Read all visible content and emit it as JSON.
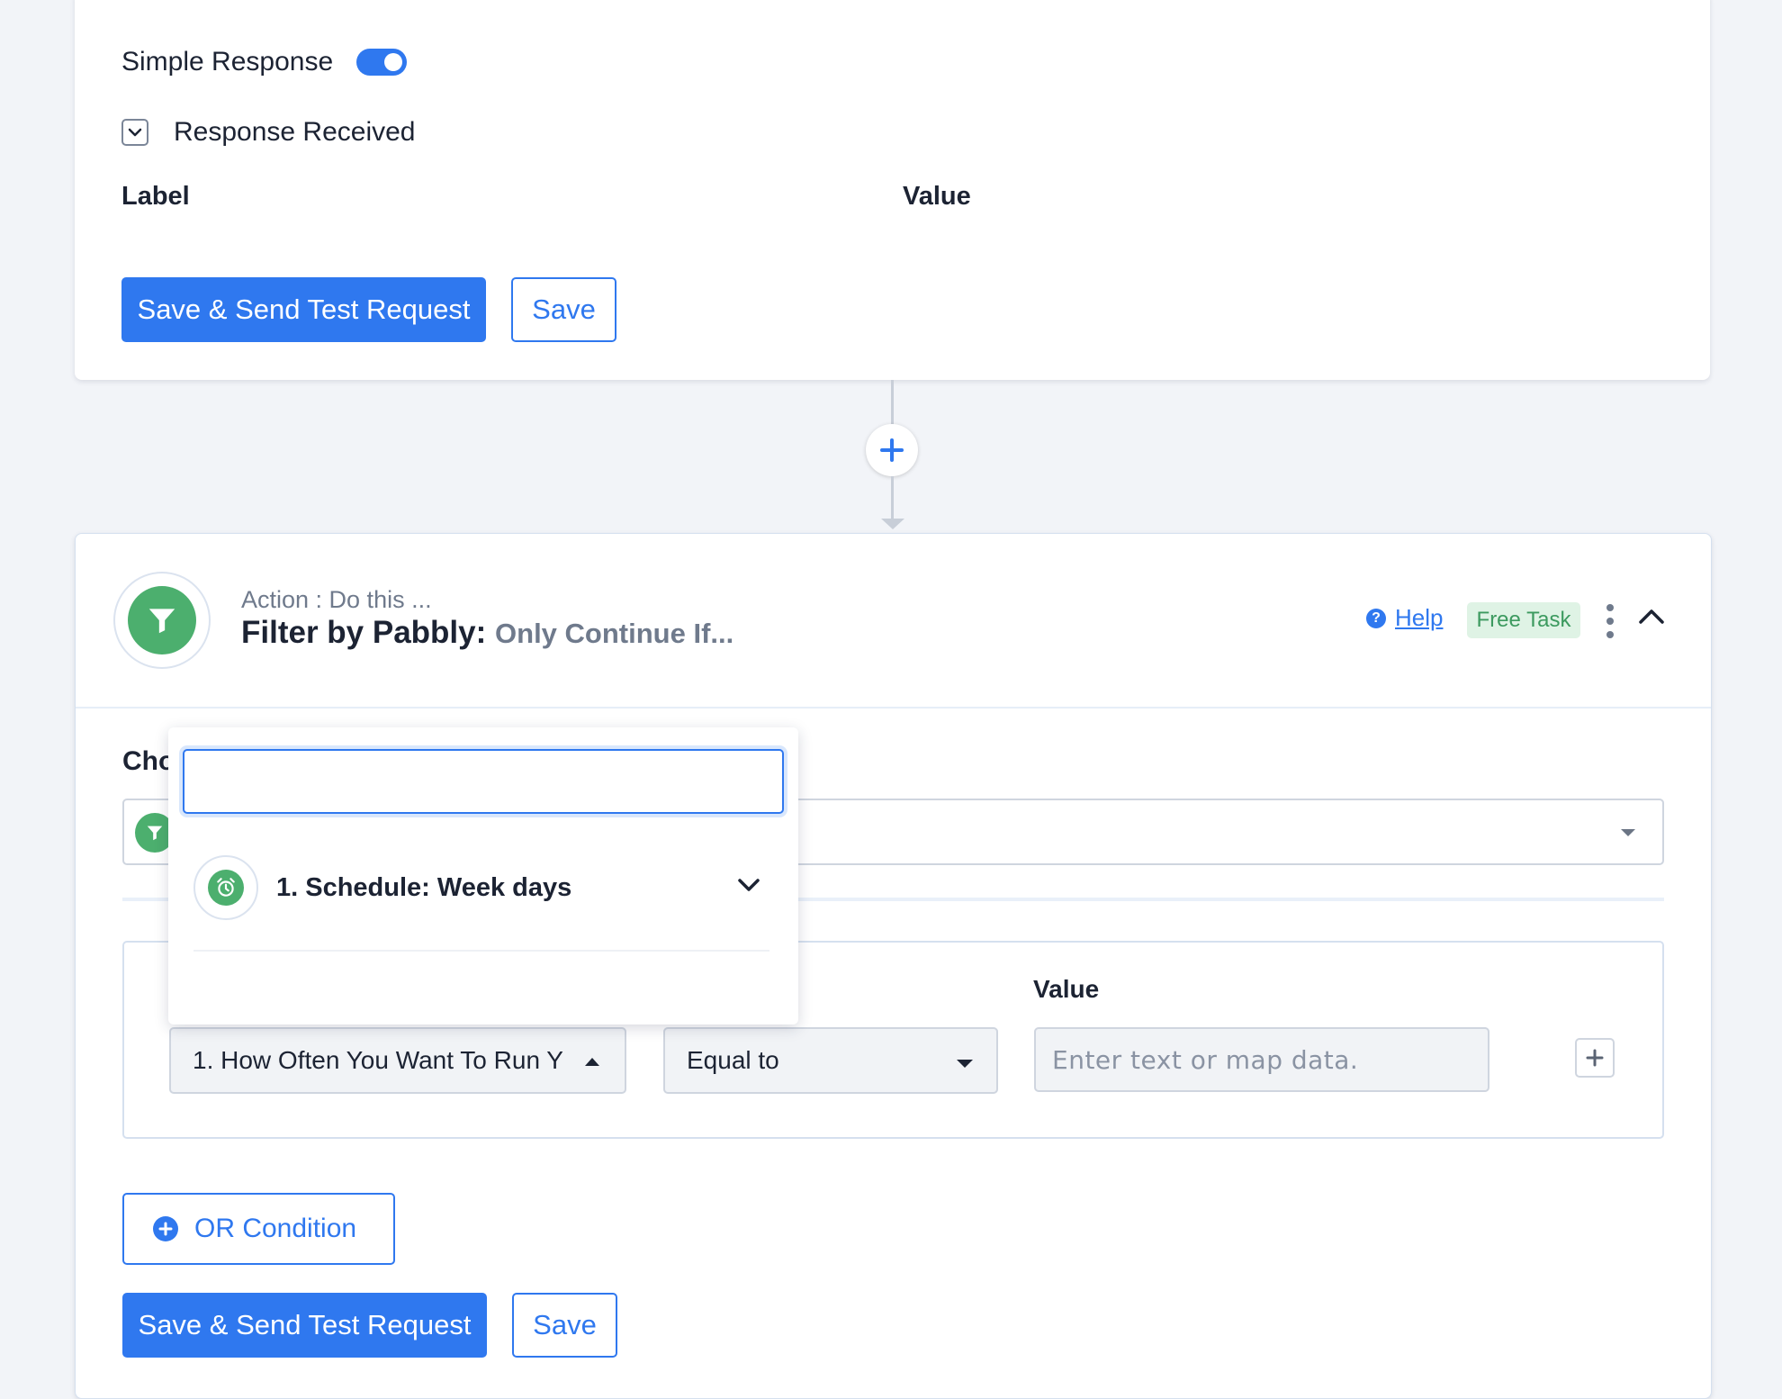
{
  "top_card": {
    "simple_response_label": "Simple Response",
    "response_received_label": "Response Received",
    "label_header": "Label",
    "value_header": "Value",
    "primary_button": "Save & Send Test Request",
    "save_button": "Save"
  },
  "action_card": {
    "subtitle": "Action : Do this ...",
    "title_app": "Filter by Pabbly:",
    "title_event": "Only Continue If...",
    "help_label": "Help",
    "badge": "Free Task",
    "choose_label": "Cho",
    "value_label": "Value",
    "field_select": "1. How Often You Want To Run Y",
    "operator_select": "Equal to",
    "value_placeholder": "Enter text or map data.",
    "or_condition": "OR Condition",
    "primary_button": "Save & Send Test Request",
    "save_button": "Save"
  },
  "dropdown": {
    "search_value": "",
    "item_label": "1. Schedule: Week days"
  },
  "colors": {
    "accent": "#2f78ef",
    "app_green": "#4caf6e",
    "badge_bg": "#dff3e5",
    "badge_text": "#3c9a5f"
  },
  "icons": {
    "toggle": "toggle-on-icon",
    "expand": "chevron-down-icon",
    "add_step": "plus-icon",
    "app": "filter-icon",
    "help": "question-circle-icon",
    "menu": "kebab-icon",
    "collapse": "chevron-up-icon",
    "schedule": "alarm-clock-icon",
    "or_add": "plus-circle-icon"
  }
}
